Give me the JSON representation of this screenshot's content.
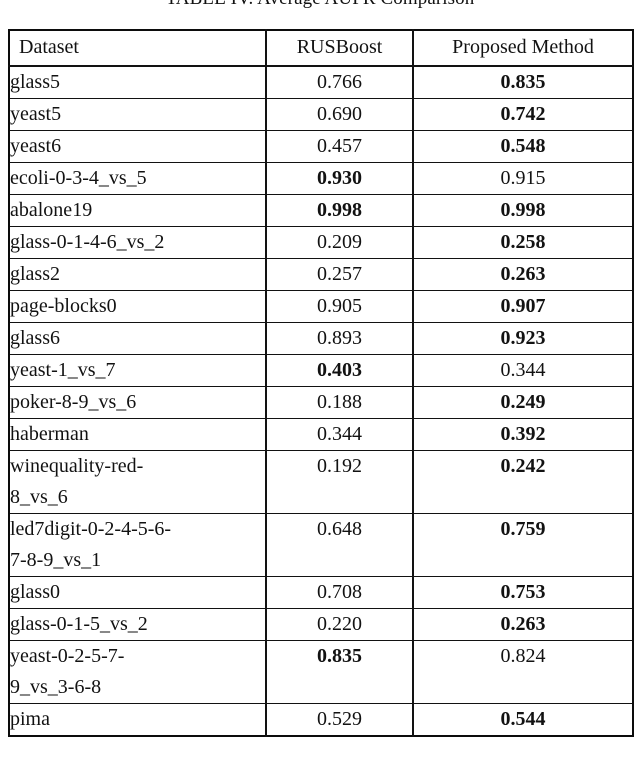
{
  "caption": "TABLE IV. Average AUPR Comparison",
  "table": {
    "columns": [
      "Dataset",
      "RUSBoost",
      "Proposed Method"
    ],
    "rows": [
      {
        "dataset": "glass5",
        "rusboost": "0.766",
        "proposed": "0.835",
        "rusboost_bold": false,
        "proposed_bold": true,
        "tall": false
      },
      {
        "dataset": "yeast5",
        "rusboost": "0.690",
        "proposed": "0.742",
        "rusboost_bold": false,
        "proposed_bold": true,
        "tall": false
      },
      {
        "dataset": "yeast6",
        "rusboost": "0.457",
        "proposed": "0.548",
        "rusboost_bold": false,
        "proposed_bold": true,
        "tall": false
      },
      {
        "dataset": "ecoli-0-3-4_vs_5",
        "rusboost": "0.930",
        "proposed": "0.915",
        "rusboost_bold": true,
        "proposed_bold": false,
        "tall": false
      },
      {
        "dataset": "abalone19",
        "rusboost": "0.998",
        "proposed": "0.998",
        "rusboost_bold": true,
        "proposed_bold": true,
        "tall": false
      },
      {
        "dataset": "glass-0-1-4-6_vs_2",
        "rusboost": "0.209",
        "proposed": "0.258",
        "rusboost_bold": false,
        "proposed_bold": true,
        "tall": false
      },
      {
        "dataset": "glass2",
        "rusboost": "0.257",
        "proposed": "0.263",
        "rusboost_bold": false,
        "proposed_bold": true,
        "tall": false
      },
      {
        "dataset": "page-blocks0",
        "rusboost": "0.905",
        "proposed": "0.907",
        "rusboost_bold": false,
        "proposed_bold": true,
        "tall": false
      },
      {
        "dataset": "glass6",
        "rusboost": "0.893",
        "proposed": "0.923",
        "rusboost_bold": false,
        "proposed_bold": true,
        "tall": false
      },
      {
        "dataset": "yeast-1_vs_7",
        "rusboost": "0.403",
        "proposed": "0.344",
        "rusboost_bold": true,
        "proposed_bold": false,
        "tall": false
      },
      {
        "dataset": "poker-8-9_vs_6",
        "rusboost": "0.188",
        "proposed": "0.249",
        "rusboost_bold": false,
        "proposed_bold": true,
        "tall": false
      },
      {
        "dataset": "haberman",
        "rusboost": "0.344",
        "proposed": "0.392",
        "rusboost_bold": false,
        "proposed_bold": true,
        "tall": false
      },
      {
        "dataset": "winequality-red-\n8_vs_6",
        "rusboost": "0.192",
        "proposed": "0.242",
        "rusboost_bold": false,
        "proposed_bold": true,
        "tall": true
      },
      {
        "dataset": "led7digit-0-2-4-5-6-\n7-8-9_vs_1",
        "rusboost": "0.648",
        "proposed": "0.759",
        "rusboost_bold": false,
        "proposed_bold": true,
        "tall": true
      },
      {
        "dataset": "glass0",
        "rusboost": "0.708",
        "proposed": "0.753",
        "rusboost_bold": false,
        "proposed_bold": true,
        "tall": false
      },
      {
        "dataset": "glass-0-1-5_vs_2",
        "rusboost": "0.220",
        "proposed": "0.263",
        "rusboost_bold": false,
        "proposed_bold": true,
        "tall": false
      },
      {
        "dataset": "yeast-0-2-5-7-\n9_vs_3-6-8",
        "rusboost": "0.835",
        "proposed": "0.824",
        "rusboost_bold": true,
        "proposed_bold": false,
        "tall": true
      },
      {
        "dataset": "pima",
        "rusboost": "0.529",
        "proposed": "0.544",
        "rusboost_bold": false,
        "proposed_bold": true,
        "tall": false
      }
    ]
  }
}
